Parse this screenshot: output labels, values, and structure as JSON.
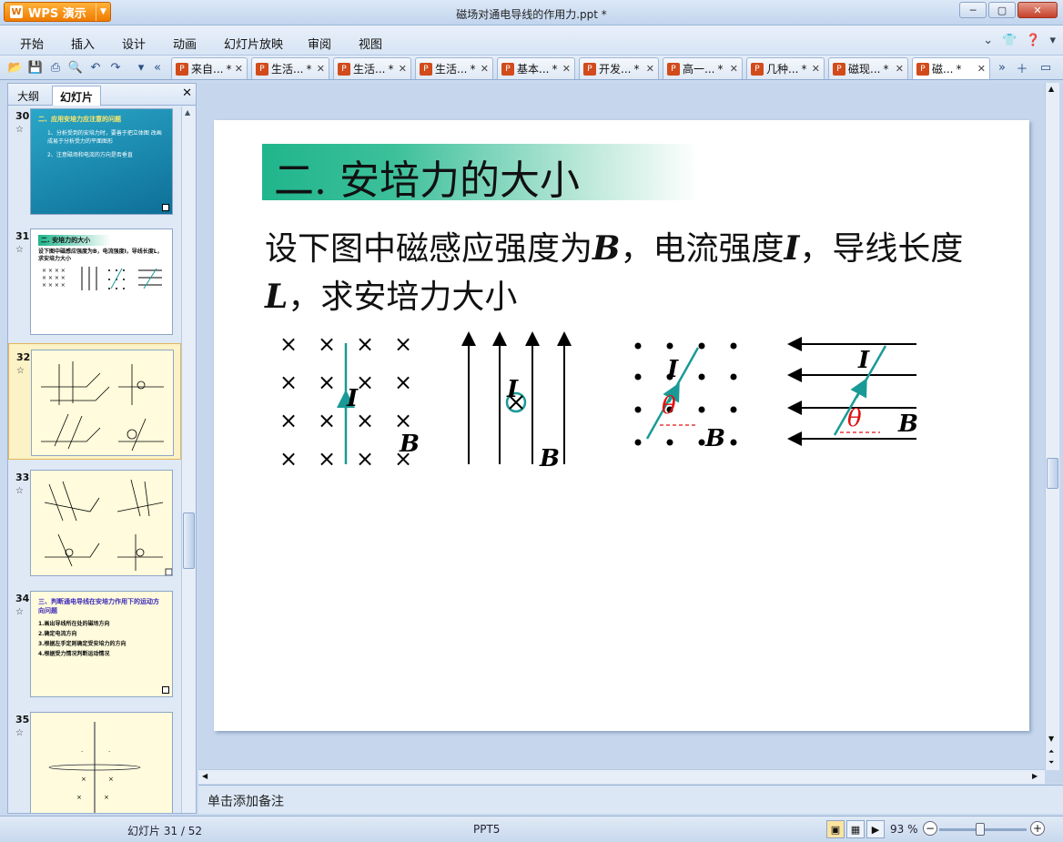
{
  "app": {
    "name": "WPS 演示",
    "window_title": "磁场对通电导线的作用力.ppt *"
  },
  "menu": {
    "items": [
      "开始",
      "插入",
      "设计",
      "动画",
      "幻灯片放映",
      "审阅",
      "视图"
    ]
  },
  "doc_tabs": [
    {
      "label": "来自...",
      "modified": "*"
    },
    {
      "label": "生活...",
      "modified": "*"
    },
    {
      "label": "生活...",
      "modified": "*"
    },
    {
      "label": "生活...",
      "modified": "*"
    },
    {
      "label": "基本...",
      "modified": "*"
    },
    {
      "label": "开发...",
      "modified": "*"
    },
    {
      "label": "高一...",
      "modified": "*"
    },
    {
      "label": "几种...",
      "modified": "*"
    },
    {
      "label": "磁现...",
      "modified": "*"
    },
    {
      "label": "磁...",
      "modified": "*"
    }
  ],
  "left_panel": {
    "tabs": [
      "大纲",
      "幻灯片"
    ],
    "active_tab": "幻灯片",
    "slides": [
      {
        "number": "30",
        "lines": [
          "二、应用安培力应注意的问题",
          "1、分析受到的安培力时，要善于把立体图 改画成易于分析受力的平面图形",
          "2、注意磁场和电流的方向是否垂直"
        ]
      },
      {
        "number": "31",
        "lines": [
          "二. 安培力的大小",
          "设下图中磁感应强度为B，电流强度I，导线长度L，求安培力大小"
        ]
      },
      {
        "number": "32"
      },
      {
        "number": "33"
      },
      {
        "number": "34",
        "lines": [
          "三、判断通电导线在安培力作用下的运动方向问题",
          "1.画出导线所在处的磁场方向",
          "2.确定电流方向",
          "3.根据左手定则确定受安培力的方向",
          "4.根据受力情况判断运动情况"
        ]
      },
      {
        "number": "35"
      }
    ],
    "selected_slide": "32"
  },
  "slide": {
    "title": "二. 安培力的大小",
    "body_parts": [
      "设下图中磁感应强度为",
      "B",
      "，电流强度",
      "I",
      "，导线长度",
      "L",
      "，求安培力大小"
    ],
    "figure_labels": {
      "current": "I",
      "field": "B",
      "angle": "θ"
    },
    "colors": {
      "title_band": "#20b58c",
      "wire": "#1a9a96",
      "angle": "#e01010"
    }
  },
  "notes": {
    "placeholder": "单击添加备注"
  },
  "status": {
    "slide_counter": "幻灯片 31 / 52",
    "template": "PPT5",
    "zoom": "93 %"
  }
}
